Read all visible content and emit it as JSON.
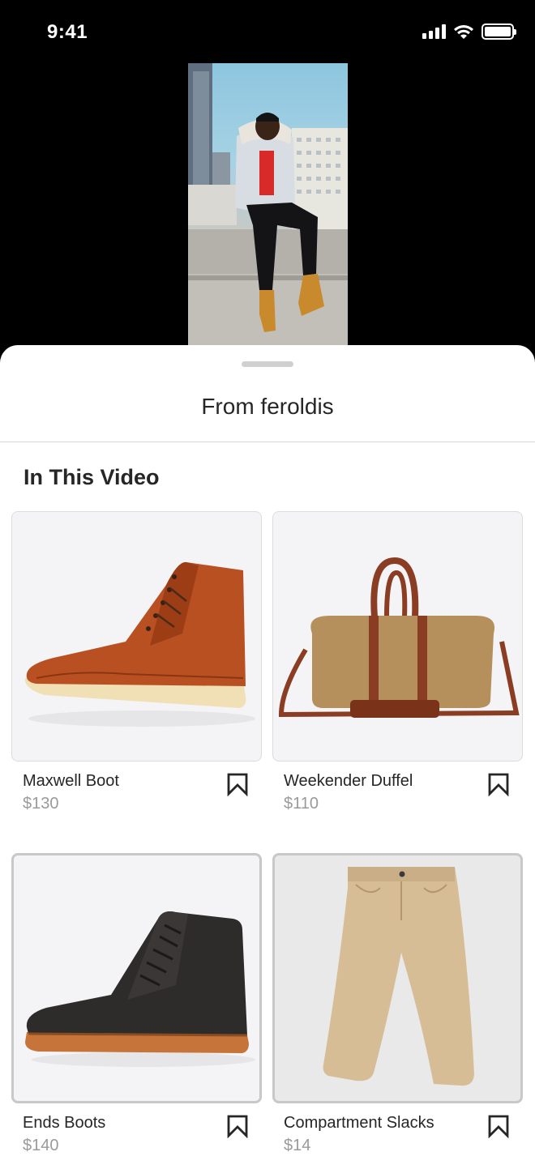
{
  "status_bar": {
    "time": "9:41"
  },
  "sheet": {
    "title": "From feroldis",
    "section_title": "In This Video"
  },
  "products": [
    {
      "name": "Maxwell Boot",
      "price": "$130",
      "image": "brown-leather-moc-toe-boot"
    },
    {
      "name": "Weekender Duffel",
      "price": "$110",
      "image": "canvas-duffel-bag"
    },
    {
      "name": "Ends Boots",
      "price": "$140",
      "image": "black-leather-boot"
    },
    {
      "name": "Compartment Slacks",
      "price": "$14",
      "image": "khaki-slacks"
    }
  ],
  "icons": {
    "save": "bookmark-icon",
    "signal": "cellular-signal-icon",
    "wifi": "wifi-icon",
    "battery": "battery-icon"
  },
  "colors": {
    "text": "#262626",
    "price": "#9a9a9a",
    "card_bg": "#f4f4f6"
  }
}
